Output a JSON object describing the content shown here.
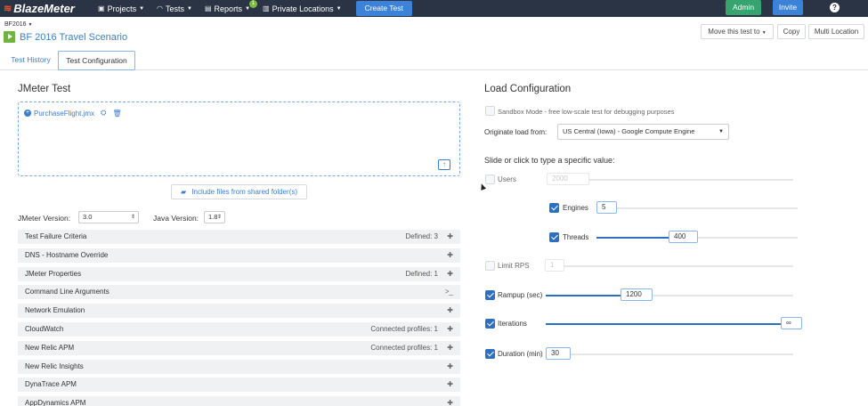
{
  "app": {
    "logo": "BlazeMeter",
    "nav": [
      {
        "label": "Projects",
        "icon": "briefcase-icon"
      },
      {
        "label": "Tests",
        "icon": "speedometer-icon"
      },
      {
        "label": "Reports",
        "icon": "document-icon",
        "badge": "1"
      },
      {
        "label": "Private Locations",
        "icon": "server-icon"
      }
    ],
    "create_test": "Create Test",
    "admin": "Admin",
    "invite": "Invite",
    "help": "?"
  },
  "header": {
    "breadcrumb": "BF2016",
    "title": "BF 2016 Travel Scenario",
    "move_btn": "Move this test to",
    "copy_btn": "Copy",
    "multi_btn": "Multi Location"
  },
  "tabs": [
    {
      "label": "Test History"
    },
    {
      "label": "Test Configuration",
      "active": true
    }
  ],
  "jmeter": {
    "title": "JMeter Test",
    "file": "PurchaseFlight.jmx",
    "include_btn": "Include files from shared folder(s)",
    "jmeter_version_label": "JMeter Version:",
    "jmeter_version": "3.0",
    "java_version_label": "Java Version:",
    "java_version": "1.8",
    "sections": [
      {
        "name": "Test Failure Criteria",
        "meta": "Defined: 3",
        "icon": "puzzle-icon"
      },
      {
        "name": "DNS - Hostname Override",
        "meta": "",
        "icon": "puzzle-icon"
      },
      {
        "name": "JMeter Properties",
        "meta": "Defined: 1",
        "icon": "puzzle-icon"
      },
      {
        "name": "Command Line Arguments",
        "meta": "",
        "icon": "terminal-icon"
      },
      {
        "name": "Network Emulation",
        "meta": "",
        "icon": "puzzle-icon"
      },
      {
        "name": "CloudWatch",
        "meta": "Connected profiles: 1",
        "icon": "puzzle-icon"
      },
      {
        "name": "New Relic APM",
        "meta": "Connected profiles: 1",
        "icon": "puzzle-icon"
      },
      {
        "name": "New Relic Insights",
        "meta": "",
        "icon": "puzzle-icon"
      },
      {
        "name": "DynaTrace APM",
        "meta": "",
        "icon": "puzzle-icon"
      },
      {
        "name": "AppDynamics APM",
        "meta": "",
        "icon": "puzzle-icon"
      }
    ]
  },
  "load": {
    "title": "Load Configuration",
    "sandbox_label": "Sandbox Mode - free low-scale test for debugging purposes",
    "originate_label": "Originate load from:",
    "originate_value": "US Central (Iowa) - Google Compute Engine",
    "slide_hint": "Slide or click to type a specific value:",
    "settings": [
      {
        "key": "users",
        "label": "Users",
        "checked": false,
        "value": "2000",
        "level": 0.0
      },
      {
        "key": "engines",
        "label": "Engines",
        "checked": true,
        "value": "5",
        "level": 0.0
      },
      {
        "key": "threads",
        "label": "Threads",
        "checked": true,
        "value": "400",
        "level": 0.4
      },
      {
        "key": "limit_rps",
        "label": "Limit RPS",
        "checked": false,
        "value": "1",
        "level": 0.0
      },
      {
        "key": "rampup",
        "label": "Rampup (sec)",
        "checked": true,
        "value": "1200",
        "level": 0.3
      },
      {
        "key": "iterations",
        "label": "Iterations",
        "checked": true,
        "value": "∞",
        "level": 1.0
      },
      {
        "key": "duration",
        "label": "Duration (min)",
        "checked": true,
        "value": "30",
        "level": 0.0
      }
    ]
  }
}
